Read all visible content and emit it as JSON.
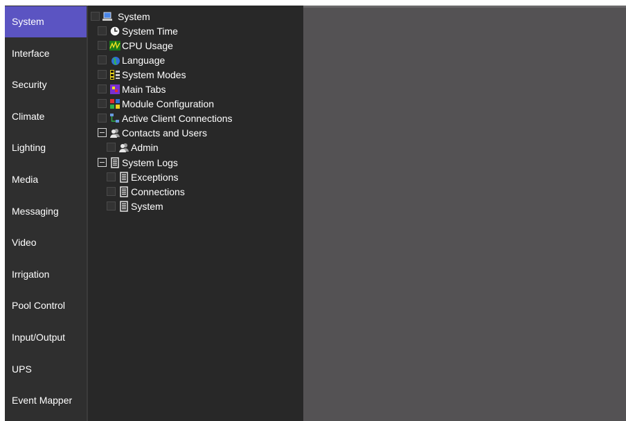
{
  "sidebar": {
    "active_index": 0,
    "active_color": "#5b54c2",
    "items": [
      {
        "label": "System"
      },
      {
        "label": "Interface"
      },
      {
        "label": "Security"
      },
      {
        "label": "Climate"
      },
      {
        "label": "Lighting"
      },
      {
        "label": "Media"
      },
      {
        "label": "Messaging"
      },
      {
        "label": "Video"
      },
      {
        "label": "Irrigation"
      },
      {
        "label": "Pool Control"
      },
      {
        "label": "Input/Output"
      },
      {
        "label": "UPS"
      },
      {
        "label": "Event Mapper"
      }
    ]
  },
  "tree": {
    "root": {
      "label": "System",
      "icon": "computer-icon",
      "checked": false
    },
    "items": [
      {
        "label": "System Time",
        "icon": "clock-icon",
        "checked": false
      },
      {
        "label": "CPU Usage",
        "icon": "cpu-graph-icon",
        "checked": false
      },
      {
        "label": "Language",
        "icon": "globe-icon",
        "checked": false
      },
      {
        "label": "System Modes",
        "icon": "modes-icon",
        "checked": false
      },
      {
        "label": "Main Tabs",
        "icon": "tabs-icon",
        "checked": false
      },
      {
        "label": "Module Configuration",
        "icon": "modules-icon",
        "checked": false
      },
      {
        "label": "Active Client Connections",
        "icon": "network-icon",
        "checked": false
      }
    ],
    "groups": [
      {
        "label": "Contacts and Users",
        "icon": "users-icon",
        "expanded": true,
        "children": [
          {
            "label": "Admin",
            "icon": "user-icon",
            "checked": false
          }
        ]
      },
      {
        "label": "System Logs",
        "icon": "log-icon",
        "expanded": true,
        "children": [
          {
            "label": "Exceptions",
            "icon": "log-icon",
            "checked": false
          },
          {
            "label": "Connections",
            "icon": "log-icon",
            "checked": false
          },
          {
            "label": "System",
            "icon": "log-icon",
            "checked": false
          }
        ]
      }
    ]
  }
}
